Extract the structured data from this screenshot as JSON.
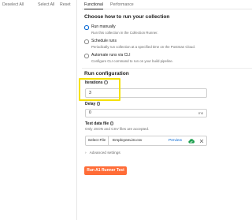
{
  "toolbar": {
    "deselect_all": "Deselect All",
    "select_all": "Select All",
    "reset": "Reset"
  },
  "tabs": [
    {
      "label": "Functional",
      "active": true
    },
    {
      "label": "Performance",
      "active": false
    }
  ],
  "run_mode": {
    "heading": "Choose how to run your collection",
    "options": [
      {
        "title": "Run manually",
        "description": "Run this collection in the Collection Runner.",
        "selected": true
      },
      {
        "title": "Schedule runs",
        "description": "Periodically run collection at a specified time on the Postman Cloud.",
        "selected": false
      },
      {
        "title": "Automate runs via CLI",
        "description": "Configure CLI command to run on your build pipeline.",
        "selected": false
      }
    ]
  },
  "run_config": {
    "heading": "Run configuration",
    "iterations_label": "Iterations",
    "iterations_value": "3",
    "delay_label": "Delay",
    "delay_value": "0",
    "delay_unit": "ms",
    "test_data_label": "Test data file",
    "test_data_hint": "Only JSON and CSV files are accepted.",
    "select_file_label": "Select File",
    "file_name": "EmployeeList.csv",
    "preview_label": "Preview",
    "advanced_label": "Advanced settings",
    "run_button_label": "Run A1 Runner Test"
  },
  "colors": {
    "accent_blue": "#0265d2",
    "run_button": "#ff6c37",
    "highlight": "#f5e10a"
  },
  "icons": {
    "info": "info-icon",
    "cloud": "cloud-check-icon",
    "close": "close-icon",
    "chevron": "chevron-right-icon"
  }
}
